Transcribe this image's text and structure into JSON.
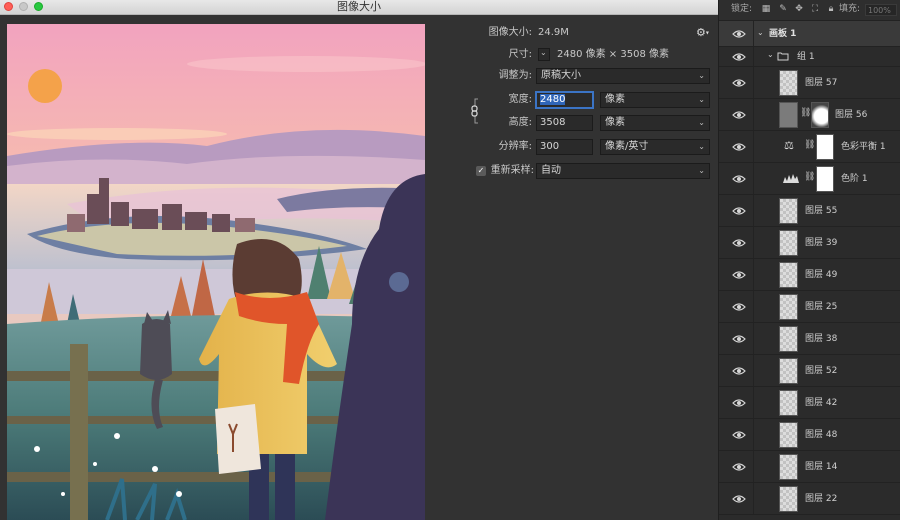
{
  "window": {
    "title": "图像大小"
  },
  "settings": {
    "image_size_label": "图像大小:",
    "image_size_value": "24.9M",
    "dimensions_label": "尺寸:",
    "dimensions_value": "2480 像素  ×  3508 像素",
    "fit_to_label": "调整为:",
    "fit_to_value": "原稿大小",
    "width_label": "宽度:",
    "width_value": "2480",
    "width_unit": "像素",
    "height_label": "高度:",
    "height_value": "3508",
    "height_unit": "像素",
    "resolution_label": "分辨率:",
    "resolution_value": "300",
    "resolution_unit": "像素/英寸",
    "resample_label": "重新采样:",
    "resample_value": "自动",
    "resample_checked": true
  },
  "layers_panel": {
    "lock_label": "锁定:",
    "fill_label": "填充:",
    "fill_value": "100%",
    "artboard": "画板 1",
    "group": "组 1",
    "layers": [
      {
        "name": "图层 57",
        "thumb": "blank"
      },
      {
        "name": "图层 56",
        "thumb": "masked"
      },
      {
        "name": "色彩平衡 1",
        "thumb": "adjust-balance"
      },
      {
        "name": "色阶 1",
        "thumb": "adjust-levels"
      },
      {
        "name": "图层 55",
        "thumb": "blank"
      },
      {
        "name": "图层 39",
        "thumb": "blank"
      },
      {
        "name": "图层 49",
        "thumb": "blank"
      },
      {
        "name": "图层 25",
        "thumb": "blank"
      },
      {
        "name": "图层 38",
        "thumb": "blank"
      },
      {
        "name": "图层 52",
        "thumb": "blank"
      },
      {
        "name": "图层 42",
        "thumb": "blank"
      },
      {
        "name": "图层 48",
        "thumb": "blank"
      },
      {
        "name": "图层 14",
        "thumb": "blank"
      },
      {
        "name": "图层 22",
        "thumb": "blank"
      }
    ]
  },
  "colors": {
    "dialog_bg": "#323232",
    "panel_bg": "#2b2b2b",
    "accent": "#2f65b8"
  }
}
